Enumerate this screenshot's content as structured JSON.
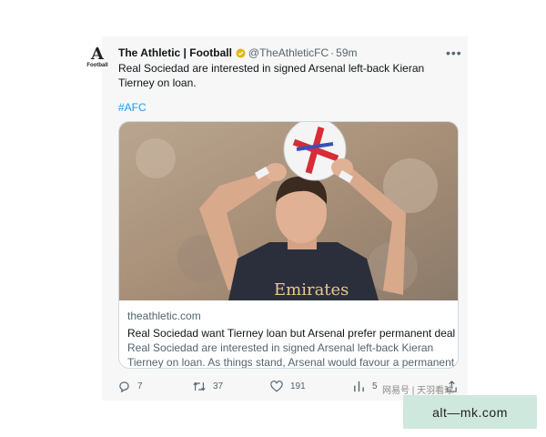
{
  "tweet": {
    "author": {
      "name": "The Athletic | Football",
      "handle": "@TheAthleticFC",
      "time": "59m",
      "avatar_letter": "A",
      "avatar_sub": "Football"
    },
    "separator": "·",
    "text": "Real Sociedad are interested in signed Arsenal left-back Kieran Tierney on loan.",
    "hashtag": "#AFC",
    "link_card": {
      "domain": "theathletic.com",
      "title": "Real Sociedad want Tierney loan but Arsenal prefer permanent deal",
      "description": "Real Sociedad are interested in signed Arsenal left-back Kieran Tierney on loan. As things stand, Arsenal would favour a permanent transfer ...",
      "image_text": "Emirates"
    },
    "actions": {
      "replies": "7",
      "retweets": "37",
      "likes": "191",
      "views": "5"
    }
  },
  "overlay": {
    "watermark_small": "网易号 | 天羽看球",
    "watermark_badge": "alt—mk.com"
  },
  "colors": {
    "link_blue": "#1d9bf0",
    "muted_text": "#536471",
    "verified_gold": "#e2b719",
    "watermark_bg": "#cfe8de"
  }
}
